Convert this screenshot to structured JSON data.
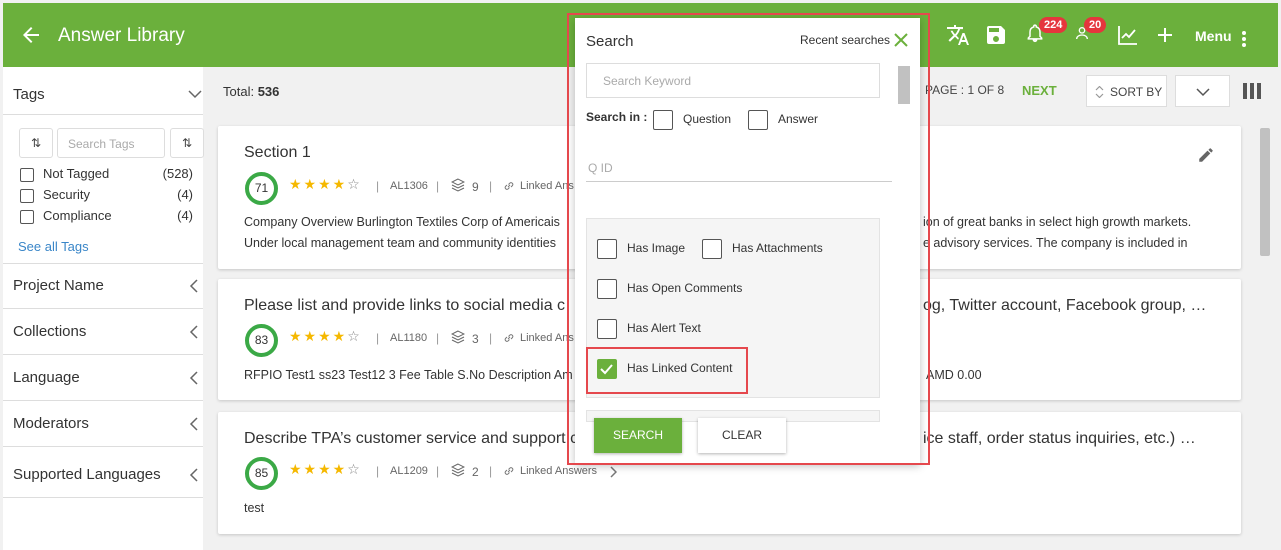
{
  "header": {
    "title": "Answer Library",
    "notifications_count": "224",
    "users_count": "20",
    "menu_label": "Menu",
    "color": "#6bb03c"
  },
  "sidebar": {
    "tags_heading": "Tags",
    "tag_search_placeholder": "Search Tags",
    "tags": [
      {
        "name": "Not Tagged",
        "count": "(528)"
      },
      {
        "name": "Security",
        "count": "(4)"
      },
      {
        "name": "Compliance",
        "count": "(4)"
      }
    ],
    "see_all": "See all Tags",
    "sections": [
      "Project Name",
      "Collections",
      "Language",
      "Moderators",
      "Supported Languages"
    ]
  },
  "toolbar": {
    "total_label": "Total:",
    "total_value": "536",
    "page_info": "PAGE : 1 OF 8",
    "next_label": "NEXT",
    "sort_by_label": "SORT BY"
  },
  "cards": [
    {
      "title": "Section 1",
      "title_right": "",
      "score": "71",
      "stars": 4,
      "id": "AL1306",
      "stack_count": "9",
      "linked": "Linked Ans",
      "line1": "Company Overview Burlington Textiles Corp of Americais",
      "line1_right": "ion of great banks in select high growth markets.",
      "line2": "Under local management team and community identities",
      "line2_right": "e advisory services. The company is included in"
    },
    {
      "title": "Please list and provide links to social media c",
      "title_right": "og, Twitter account, Facebook group, …",
      "score": "83",
      "stars": 4,
      "id": "AL1180",
      "stack_count": "3",
      "linked": "Linked Ans",
      "line1": "RFPIO Test1 ss23 Test12 3 Fee Table S.No Description Am",
      "line1_right": "AMD 0.00"
    },
    {
      "title": "Describe TPA’s customer service and support c",
      "title_right": "ice staff, order status inquiries, etc.) …",
      "score": "85",
      "stars": 4,
      "id": "AL1209",
      "stack_count": "2",
      "linked": "Linked Answers",
      "line1": "test"
    }
  ],
  "search_panel": {
    "title": "Search",
    "recent_searches": "Recent searches",
    "keyword_placeholder": "Search Keyword",
    "search_in_label": "Search in :",
    "search_in_options": [
      "Question",
      "Answer"
    ],
    "qid_placeholder": "Q ID",
    "filters": [
      {
        "label": "Has Image",
        "checked": false
      },
      {
        "label": "Has Attachments",
        "checked": false
      },
      {
        "label": "Has Open Comments",
        "checked": false
      },
      {
        "label": "Has Alert Text",
        "checked": false
      },
      {
        "label": "Has Linked Content",
        "checked": true
      }
    ],
    "search_button": "SEARCH",
    "clear_button": "CLEAR"
  }
}
